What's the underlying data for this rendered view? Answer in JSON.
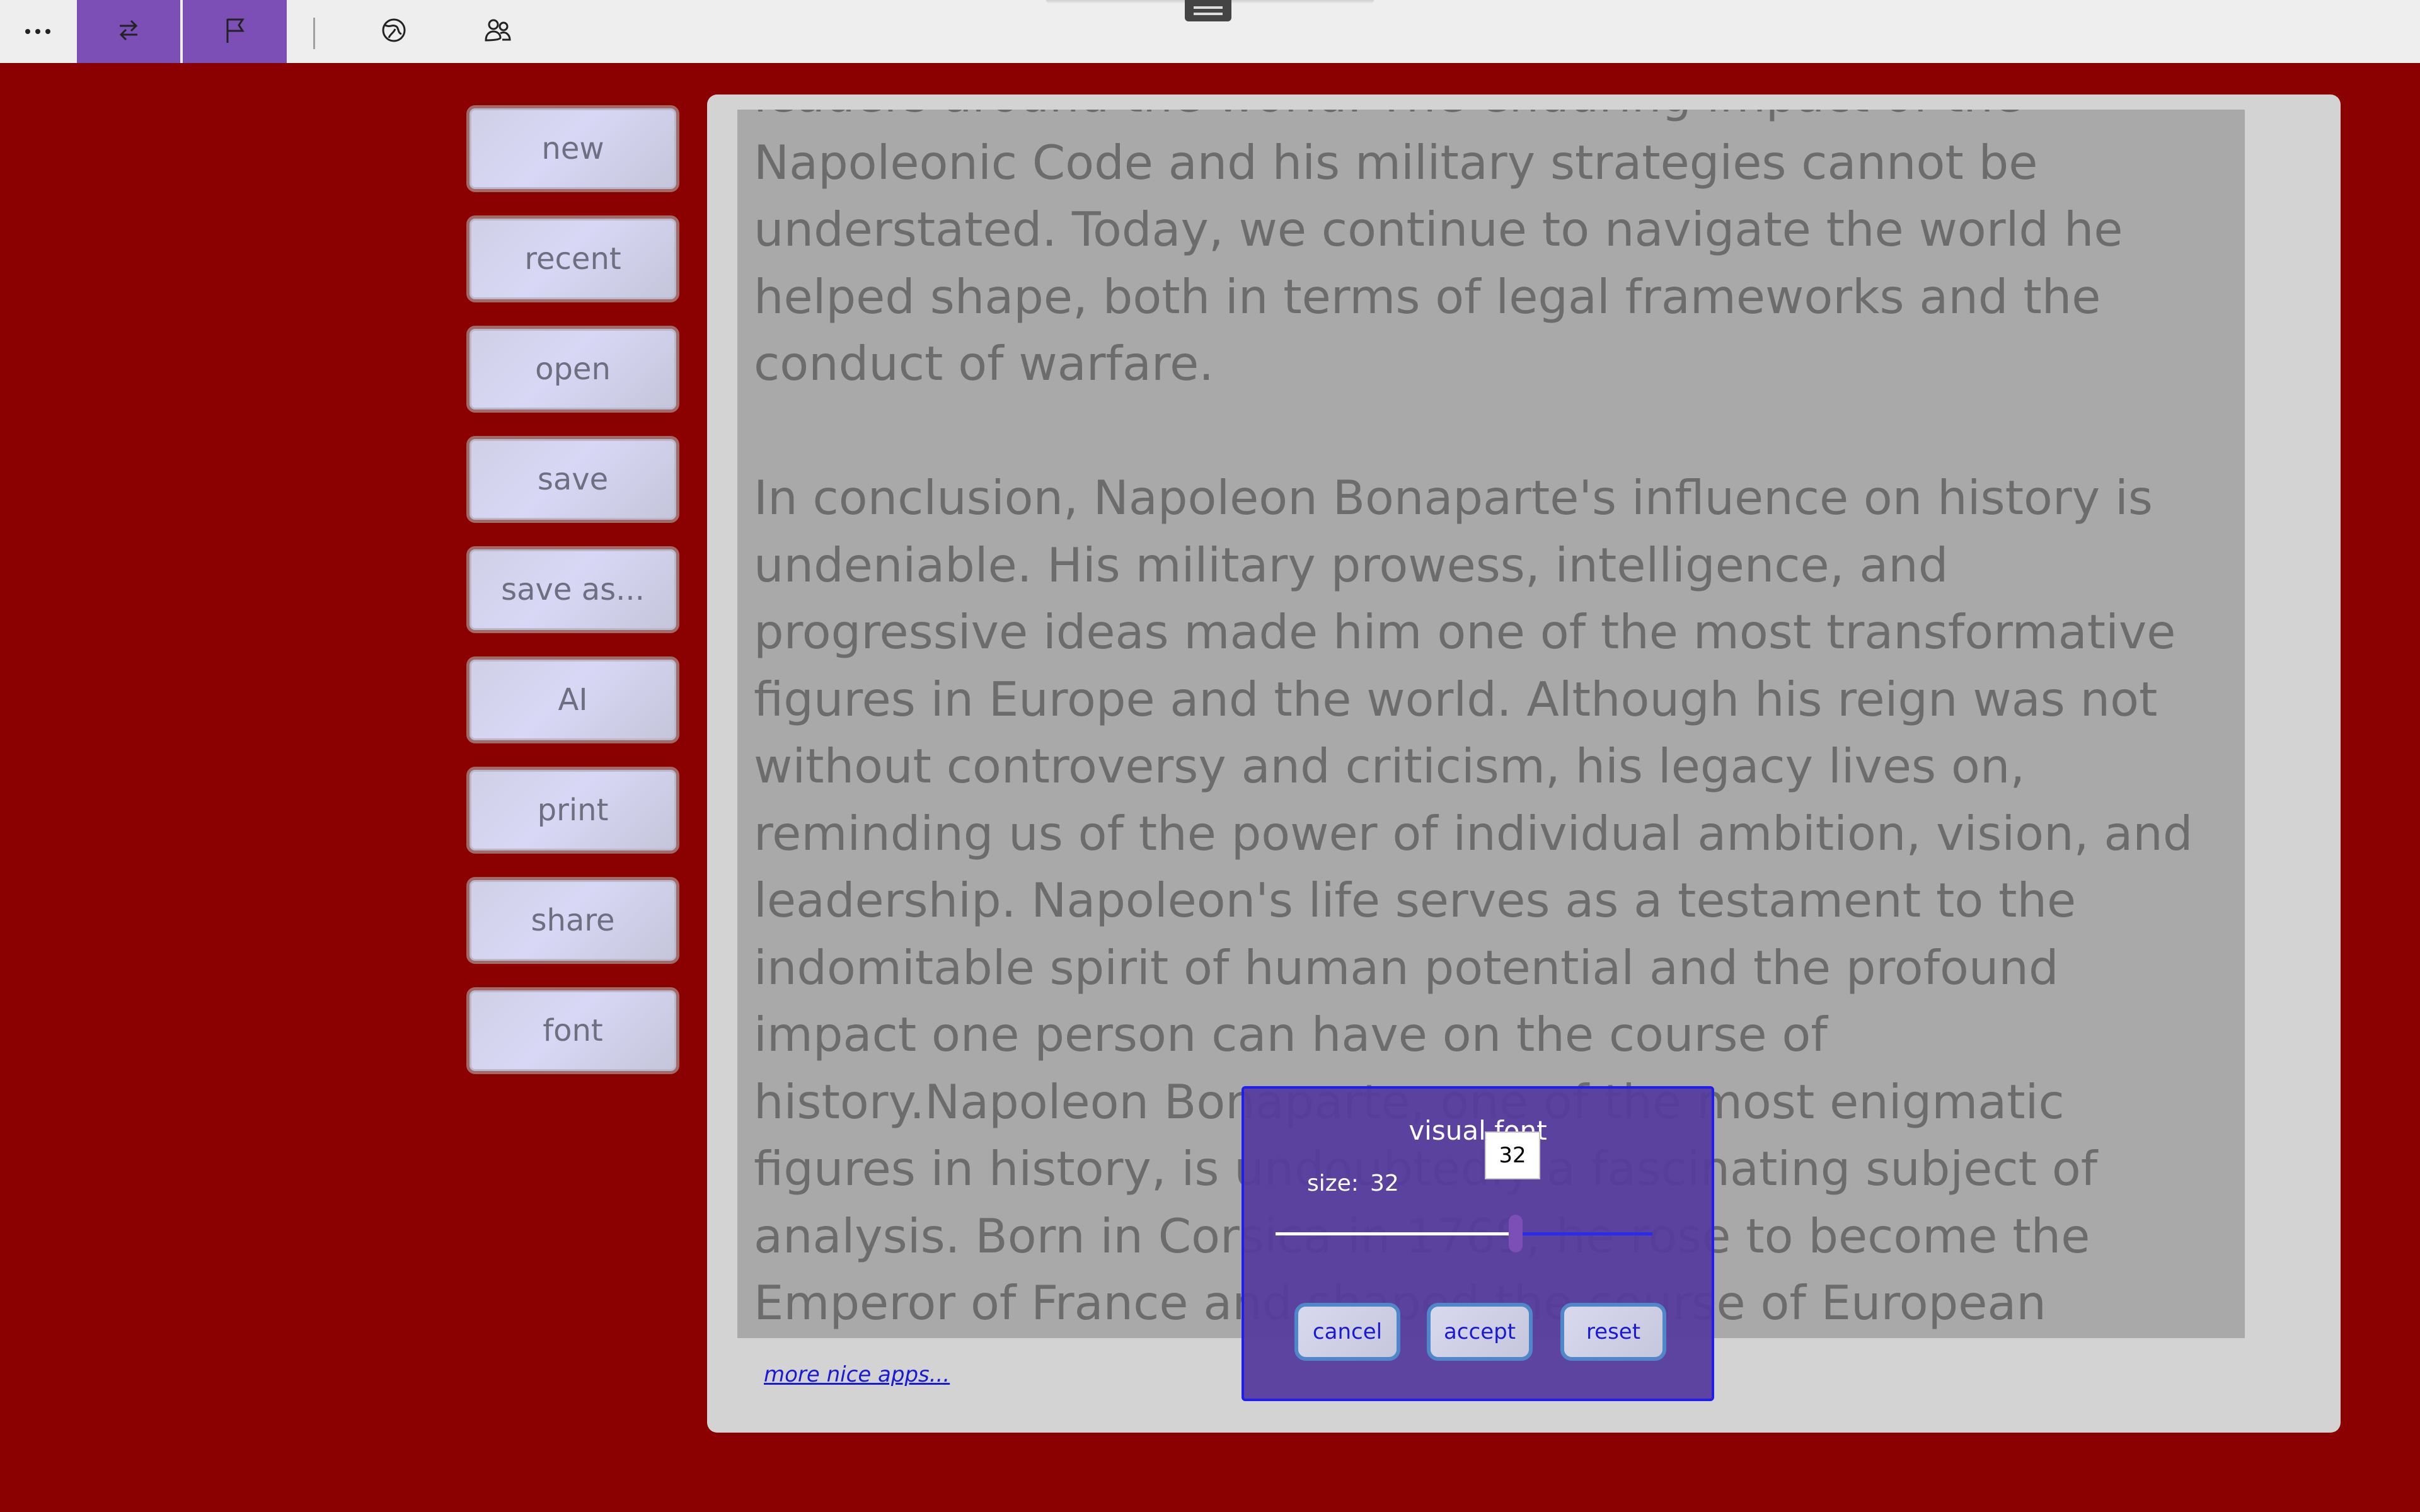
{
  "toolbar": {
    "more_icon": "ellipsis-icon",
    "swap_icon": "swap-arrows-icon",
    "flag_icon": "flag-icon",
    "globe_icon": "globe-icon",
    "people_icon": "people-icon"
  },
  "menu": [
    {
      "label": "new"
    },
    {
      "label": "recent"
    },
    {
      "label": "open"
    },
    {
      "label": "save"
    },
    {
      "label": "save as..."
    },
    {
      "label": "AI"
    },
    {
      "label": "print"
    },
    {
      "label": "share"
    },
    {
      "label": "font"
    }
  ],
  "document": {
    "text": "leaders around the world. The enduring impact of the Napoleonic Code and his military strategies cannot be understated. Today, we continue to navigate the world he helped shape, both in terms of legal frameworks and the conduct of warfare.\n\nIn conclusion, Napoleon Bonaparte's influence on history is undeniable. His military prowess, intelligence, and progressive ideas made him one of the most transformative figures in Europe and the world. Although his reign was not without controversy and criticism, his legacy lives on, reminding us of the power of individual ambition, vision, and leadership. Napoleon's life serves as a testament to the indomitable spirit of human potential and the profound impact one person can have on the course of history.Napoleon Bonaparte, one of the most enigmatic figures in history, is undoubtedly a fascinating subject of analysis. Born in Corsica in 1769, he rose to become the Emperor of France and shaped the course of European history. Napoleon’s impact on politics, warfare, and governance still lingers today, making him a remarkable and influential historical figure."
  },
  "footer": {
    "more_apps": "more nice apps..."
  },
  "font_dialog": {
    "title": "visual font",
    "size_label": "size:",
    "size_value": "32",
    "slider_tooltip": "32",
    "slider_fraction": 0.58,
    "cancel": "cancel",
    "accept": "accept",
    "reset": "reset"
  },
  "colors": {
    "background": "#8b0000",
    "accent": "#7b4fb5",
    "dialog": "#563c9e"
  }
}
